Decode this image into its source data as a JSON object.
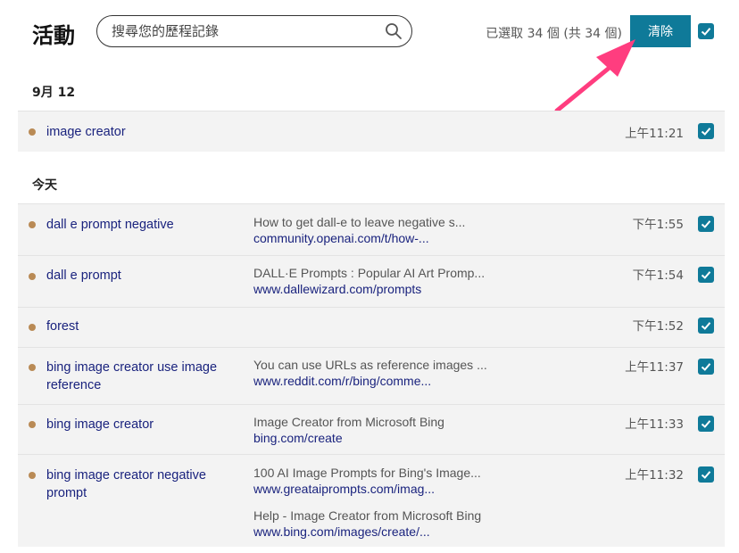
{
  "header": {
    "title": "活動",
    "search_placeholder": "搜尋您的歷程記錄",
    "selected_count": "已選取 34 個 (共 34 個)",
    "clear_label": "清除"
  },
  "sections": [
    {
      "label": "9月 12",
      "items": [
        {
          "query": "image creator",
          "time": "上午11:21",
          "checked": true
        }
      ]
    },
    {
      "label": "今天",
      "items": [
        {
          "query": "dall e prompt negative",
          "desc": "How to get dall-e to leave negative s...",
          "url": "community.openai.com/t/how-...",
          "time": "下午1:55",
          "checked": true
        },
        {
          "query": "dall e prompt",
          "desc": "DALL·E Prompts : Popular AI Art Promp...",
          "url": "www.dallewizard.com/prompts",
          "time": "下午1:54",
          "checked": true
        },
        {
          "query": "forest",
          "time": "下午1:52",
          "checked": true
        },
        {
          "query_line1": "bing image creator use image",
          "query_line2": "reference",
          "desc": "You can use URLs as reference images ...",
          "url": "www.reddit.com/r/bing/comme...",
          "time": "上午11:37",
          "checked": true
        },
        {
          "query": "bing image creator",
          "desc": "Image Creator from Microsoft Bing",
          "url": "bing.com/create",
          "time": "上午11:33",
          "checked": true
        },
        {
          "query_line1": "bing image creator negative",
          "query_line2": "prompt",
          "desc": "100 AI Image Prompts for Bing's Image...",
          "url": "www.greataiprompts.com/imag...",
          "desc2": "Help - Image Creator from Microsoft Bing",
          "url2": "www.bing.com/images/create/...",
          "time": "上午11:32",
          "checked": true
        }
      ]
    }
  ],
  "colors": {
    "accent": "#0f7a99",
    "link": "#1a237e",
    "dot": "#b98a55",
    "arrow": "#ff3d7f",
    "row_bg": "#f3f3f3"
  },
  "icons": {
    "search": "search-icon",
    "check": "checkmark-icon",
    "arrow": "annotation-arrow"
  }
}
